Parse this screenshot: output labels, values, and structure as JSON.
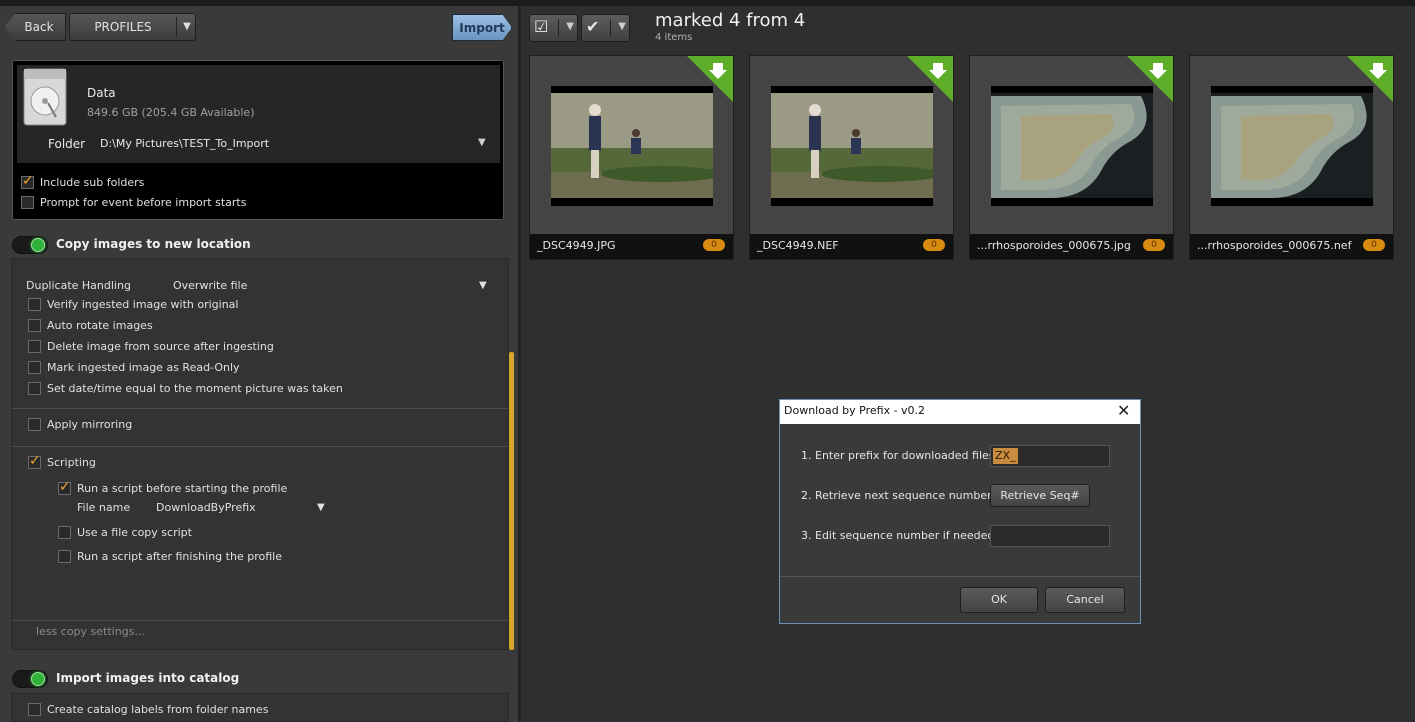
{
  "header": {
    "back_label": "Back",
    "profiles_label": "PROFILES",
    "profiles_arrow": "▼",
    "import_label": "Import"
  },
  "source": {
    "drive_name": "Data",
    "drive_space": "849.6 GB (205.4 GB Available)",
    "folder_label": "Folder",
    "folder_path": "D:\\My Pictures\\TEST_To_Import",
    "folder_arrow": "▼",
    "include_sub_folders": "Include sub folders",
    "prompt_event": "Prompt for event before import starts"
  },
  "copy": {
    "title": "Copy images to new location",
    "duplicate_label": "Duplicate Handling",
    "duplicate_value": "Overwrite file",
    "duplicate_arrow": "▼",
    "options": [
      "Verify ingested image with original",
      "Auto rotate images",
      "Delete image from source after ingesting",
      "Mark ingested image as Read-Only",
      "Set date/time equal to the moment picture was taken"
    ],
    "mirroring": "Apply mirroring",
    "scripting": "Scripting",
    "run_before": "Run a script before starting the profile",
    "file_name_label": "File name",
    "file_name_value": "DownloadByPrefix",
    "file_name_arrow": "▼",
    "file_copy_script": "Use a file copy script",
    "run_after": "Run a script after finishing the profile",
    "less_settings": "less copy settings..."
  },
  "catalog": {
    "title": "Import images into catalog",
    "labels_option": "Create catalog labels from folder names"
  },
  "browser": {
    "title": "marked 4 from 4",
    "count": "4 items",
    "thumbs": [
      {
        "name": "_DSC4949.JPG",
        "badge": "0"
      },
      {
        "name": "_DSC4949.NEF",
        "badge": "0"
      },
      {
        "name": "...rrhosporoides_000675.jpg",
        "badge": "0"
      },
      {
        "name": "...rrhosporoides_000675.nef",
        "badge": "0"
      }
    ]
  },
  "dialog": {
    "title": "Download by Prefix - v0.2",
    "close": "✕",
    "step1": "1. Enter prefix for downloaded files",
    "prefix_value": "ZX_",
    "step2": "2. Retrieve next sequence number",
    "retrieve_label": "Retrieve Seq#",
    "step3": "3. Edit sequence number if needed",
    "ok_label": "OK",
    "cancel_label": "Cancel"
  },
  "colors": {
    "accent_orange": "#f0a030",
    "toggle_green": "#2fb23a",
    "dialog_border": "#6b8fb3"
  }
}
